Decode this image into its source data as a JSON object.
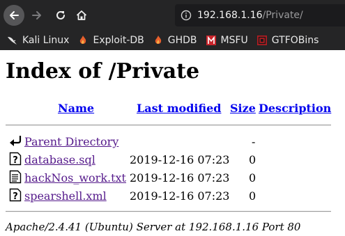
{
  "browser": {
    "url_host": "192.168.1.16",
    "url_path": "/Private/",
    "bookmarks": [
      {
        "label": "Kali Linux",
        "icon": "kali-dragon-icon"
      },
      {
        "label": "Exploit-DB",
        "icon": "exploit-db-icon"
      },
      {
        "label": "GHDB",
        "icon": "ghdb-icon"
      },
      {
        "label": "MSFU",
        "icon": "msfu-icon"
      },
      {
        "label": "GTFOBins",
        "icon": "gtfobins-icon"
      }
    ]
  },
  "page": {
    "title": "Index of /Private",
    "columns": {
      "name": "Name",
      "last_modified": "Last modified",
      "size": "Size",
      "description": "Description"
    },
    "parent": {
      "name": "Parent Directory",
      "size": "-",
      "icon": "back-arrow-icon"
    },
    "files": [
      {
        "name": "database.sql",
        "modified": "2019-12-16 07:23",
        "size": "0",
        "icon": "unknown-file-icon"
      },
      {
        "name": "hackNos_work.txt",
        "modified": "2019-12-16 07:23",
        "size": "0",
        "icon": "text-file-icon"
      },
      {
        "name": "spearshell.xml",
        "modified": "2019-12-16 07:23",
        "size": "0",
        "icon": "unknown-file-icon"
      }
    ],
    "footer": "Apache/2.4.41 (Ubuntu) Server at 192.168.1.16 Port 80"
  }
}
